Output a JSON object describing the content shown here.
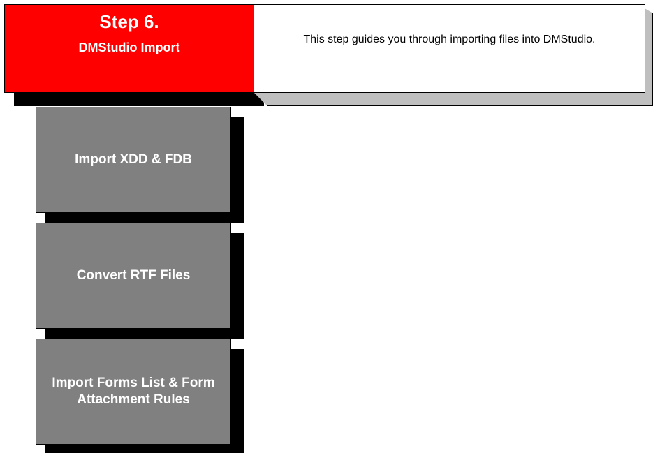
{
  "header": {
    "step_title": "Step 6.",
    "step_subtitle": "DMStudio Import",
    "description": "This step guides you through importing files into DMStudio."
  },
  "steps": [
    {
      "label": "Import XDD & FDB"
    },
    {
      "label": "Convert RTF Files"
    },
    {
      "label": "Import Forms List & Form Attachment Rules"
    }
  ],
  "colors": {
    "step_header": "#ff0000",
    "box_fill": "#808080",
    "shadow": "#000000",
    "desc_shadow": "#bfbfbf"
  }
}
